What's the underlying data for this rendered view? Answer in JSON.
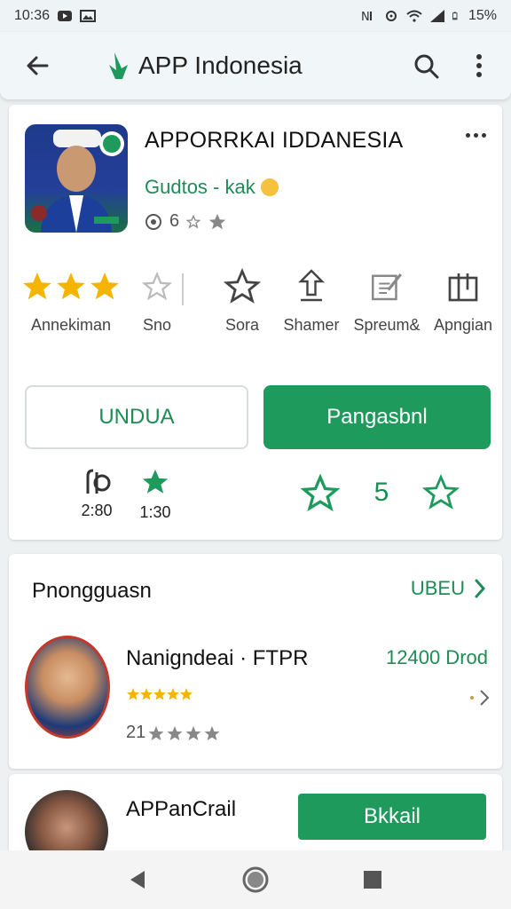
{
  "status_bar": {
    "time": "10:36",
    "battery": "15%"
  },
  "app_bar": {
    "title": "APP Indonesia"
  },
  "app_card": {
    "name": "APPORRKAI IDDANESIA",
    "developer": "Gudtos - kak",
    "rating_label": "6",
    "action_labels": [
      "Annekiman",
      "Sno",
      "Sora",
      "Shamer",
      "Spreum&",
      "Apngian"
    ],
    "outline_button": "UNDUA",
    "primary_button": "Pangasbnl",
    "stat_1": "2:80",
    "stat_2": "1:30",
    "stat_3": "5"
  },
  "section": {
    "title": "Pnongguasn",
    "link": "UBEU",
    "item": {
      "title": "Nanigndeai · FTPR",
      "right_text": "12400 Drod",
      "sub_number": "21"
    }
  },
  "row3": {
    "title": "APPanCrail",
    "button": "Bkkail"
  },
  "colors": {
    "accent": "#1e9a5c",
    "star": "#f5b400"
  }
}
